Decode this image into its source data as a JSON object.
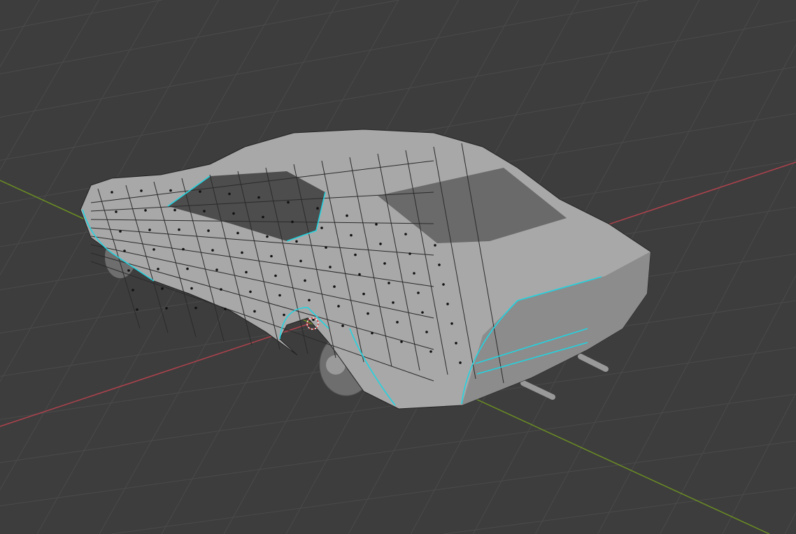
{
  "viewport": {
    "mode": "edit-mode-3d-viewport",
    "colors": {
      "background": "#3d3d3d",
      "grid": "#484848",
      "x_axis": "#b0424d",
      "y_axis": "#6b8e23",
      "body": "#a8a8a8",
      "body_dark": "#7e7e7e",
      "glass": "#5a5a5a",
      "wire": "#1a1a1a",
      "selected_edge": "#22d3e0",
      "cursor": "#e04040"
    },
    "object": {
      "name_icon": "car-mesh"
    }
  }
}
